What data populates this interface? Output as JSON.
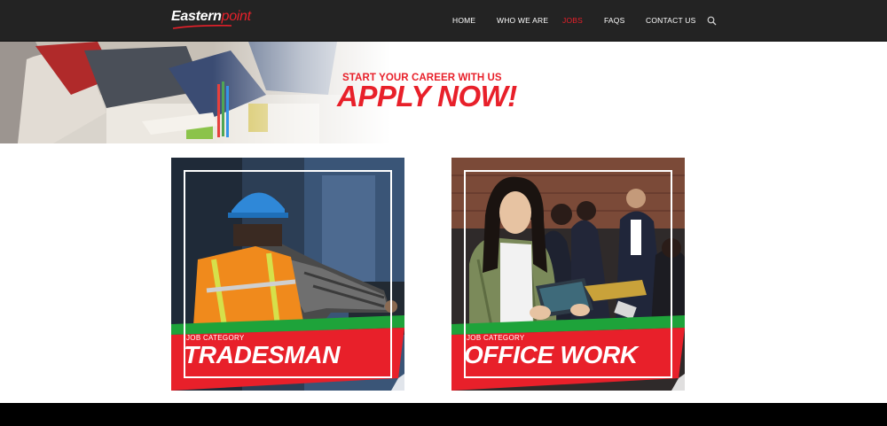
{
  "brand": {
    "logo_part1": "Eastern",
    "logo_part2": "point"
  },
  "nav": {
    "items": [
      {
        "label": "HOME",
        "active": false
      },
      {
        "label": "WHO WE ARE",
        "active": false
      },
      {
        "label": "JOBS",
        "active": true
      },
      {
        "label": "FAQS",
        "active": false
      },
      {
        "label": "CONTACT US",
        "active": false
      }
    ],
    "search_icon": "search-icon"
  },
  "hero": {
    "subtitle": "START YOUR CAREER WITH US",
    "title": "APPLY NOW!"
  },
  "categories": [
    {
      "label": "JOB CATEGORY",
      "title": "TRADESMAN"
    },
    {
      "label": "JOB CATEGORY",
      "title": "OFFICE WORK"
    }
  ],
  "colors": {
    "accent_red": "#e8202a",
    "accent_green": "#1ea33a",
    "nav_bg": "#232323"
  }
}
